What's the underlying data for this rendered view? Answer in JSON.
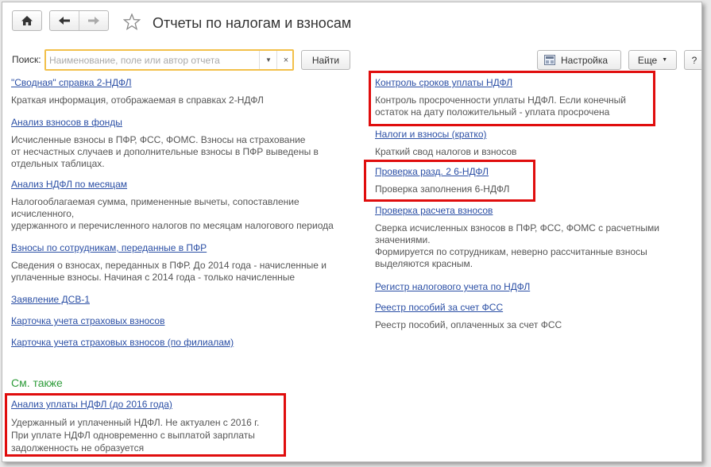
{
  "header": {
    "title": "Отчеты по налогам и взносам"
  },
  "search": {
    "label": "Поиск:",
    "placeholder": "Наименование, поле или автор отчета",
    "clear_symbol": "×",
    "find_label": "Найти"
  },
  "toolbar": {
    "settings_label": "Настройка",
    "more_label": "Еще",
    "help_label": "?"
  },
  "left": {
    "items": [
      {
        "title": "\"Сводная\" справка 2-НДФЛ",
        "desc": [
          "Краткая информация, отображаемая в справках 2-НДФЛ"
        ]
      },
      {
        "title": "Анализ взносов в фонды",
        "desc": [
          "Исчисленные взносы в ПФР, ФСС, ФОМС. Взносы на страхование",
          "от несчастных случаев и дополнительные взносы в ПФР выведены в",
          "отдельных таблицах."
        ]
      },
      {
        "title": "Анализ НДФЛ по месяцам",
        "desc": [
          "Налогооблагаемая сумма, примененные вычеты, сопоставление",
          "исчисленного,",
          "удержанного и перечисленного налогов по месяцам налогового периода"
        ]
      },
      {
        "title": "Взносы по сотрудникам, переданные в ПФР",
        "desc": [
          "Сведения о взносах, переданных в ПФР. До 2014 года - начисленные и",
          "уплаченные взносы. Начиная с 2014 года - только начисленные"
        ]
      },
      {
        "title": "Заявление ДСВ-1",
        "desc": []
      },
      {
        "title": "Карточка учета страховых взносов",
        "desc": []
      },
      {
        "title": "Карточка учета страховых взносов (по филиалам)",
        "desc": []
      }
    ]
  },
  "right": {
    "items": [
      {
        "title": "Контроль сроков уплаты НДФЛ",
        "desc": [
          "Контроль просроченности уплаты НДФЛ. Если конечный",
          "остаток на дату положительный - уплата просрочена"
        ]
      },
      {
        "title": "Налоги и взносы (кратко)",
        "desc": [
          "Краткий свод налогов и взносов"
        ]
      },
      {
        "title": "Проверка разд. 2 6-НДФЛ",
        "desc": [
          "Проверка заполнения 6-НДФЛ"
        ]
      },
      {
        "title": "Проверка расчета взносов",
        "desc": [
          "Сверка исчисленных взносов в ПФР, ФСС, ФОМС с расчетными",
          "значениями.",
          "Формируется по сотрудникам, неверно рассчитанные взносы",
          "выделяются красным."
        ]
      },
      {
        "title": "Регистр налогового учета по НДФЛ",
        "desc": []
      },
      {
        "title": "Реестр пособий за счет ФСС",
        "desc": [
          "Реестр пособий, оплаченных за счет ФСС"
        ]
      }
    ]
  },
  "see_also": {
    "heading": "См. также",
    "items": [
      {
        "title": "Анализ уплаты НДФЛ (до 2016 года)",
        "desc": [
          "Удержанный и уплаченный НДФЛ. Не актуален с 2016 г.",
          "При уплате НДФЛ одновременно с выплатой зарплаты",
          "задолженность не образуется"
        ]
      }
    ]
  },
  "colors": {
    "link": "#2b4fa5",
    "highlight_border": "#e00d0d",
    "see_also_heading": "#2e9c3a",
    "search_border": "#f2c04a"
  },
  "icons": {
    "home": "home-icon",
    "back": "arrow-left-icon",
    "forward": "arrow-right-icon",
    "favorite": "star-icon",
    "settings": "settings-icon",
    "more": "chevron-down-icon"
  }
}
